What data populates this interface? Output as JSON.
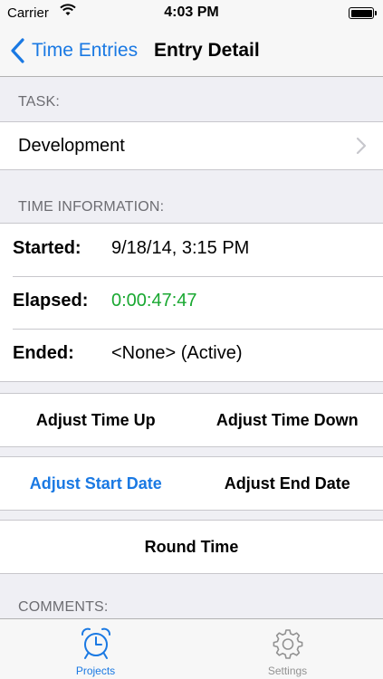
{
  "status_bar": {
    "carrier": "Carrier",
    "time": "4:03 PM"
  },
  "nav": {
    "back_label": "Time Entries",
    "title": "Entry Detail"
  },
  "task_section": {
    "header": "TASK:",
    "value": "Development"
  },
  "time_section": {
    "header": "TIME INFORMATION:",
    "rows": [
      {
        "label": "Started:",
        "value": "9/18/14, 3:15 PM"
      },
      {
        "label": "Elapsed:",
        "value": "0:00:47:47"
      },
      {
        "label": "Ended:",
        "value": "<None>  (Active)"
      }
    ]
  },
  "buttons": {
    "adjust_time_up": "Adjust Time Up",
    "adjust_time_down": "Adjust Time Down",
    "adjust_start_date": "Adjust Start Date",
    "adjust_end_date": "Adjust End Date",
    "round_time": "Round Time"
  },
  "comments_section": {
    "header": "COMMENTS:"
  },
  "tab_bar": {
    "tabs": [
      {
        "label": "Projects",
        "icon": "alarm-clock-icon",
        "active": true
      },
      {
        "label": "Settings",
        "icon": "gear-icon",
        "active": false
      }
    ]
  },
  "colors": {
    "accent": "#1a79e3",
    "elapsed_green": "#19a831",
    "background": "#efeff4"
  }
}
